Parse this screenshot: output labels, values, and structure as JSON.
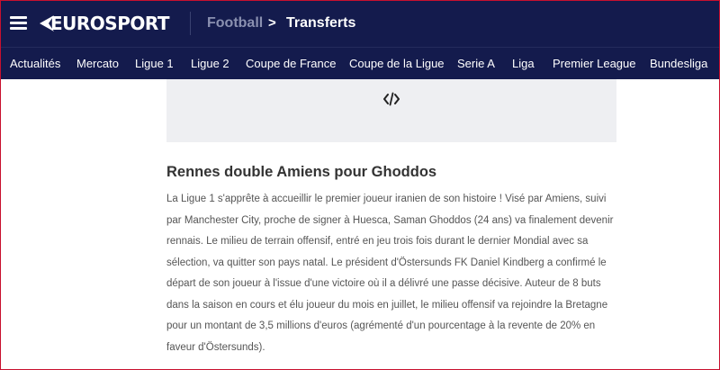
{
  "header": {
    "logo_text": "EUROSPORT",
    "breadcrumb": [
      "Football",
      "Transferts"
    ],
    "breadcrumb_separator": ">"
  },
  "nav": {
    "items": [
      "Actualités",
      "Mercato",
      "Ligue 1",
      "Ligue 2",
      "Coupe de France",
      "Coupe de la Ligue",
      "Serie A",
      "Liga",
      "Premier League",
      "Bundesliga"
    ]
  },
  "embed": {
    "icon": "code-icon"
  },
  "article": {
    "heading": "Rennes double Amiens pour Ghoddos",
    "lines": [
      "La Ligue 1 s'apprête à accueillir le premier joueur iranien de son histoire ! Visé par Amiens, suivi",
      "par Manchester City, proche de signer à Huesca, Saman Ghoddos (24 ans) va finalement devenir",
      "rennais. Le milieu de terrain offensif, entré en jeu trois fois durant le dernier Mondial avec sa",
      "sélection, va quitter son pays natal. Le président d'Östersunds FK Daniel Kindberg a confirmé le",
      "départ de son joueur à l'issue d'une victoire où il a délivré une passe décisive. Auteur de 8 buts",
      "dans la saison en cours et élu joueur du mois en juillet, le milieu offensif va rejoindre la Bretagne",
      "pour un montant de 3,5 millions d'euros (agrémenté d'un pourcentage à la revente de 20% en",
      "faveur d'Östersunds)."
    ]
  },
  "colors": {
    "header_bg": "#141b4d",
    "embed_bg": "#eeeff2",
    "heading_text": "#333333",
    "body_text": "#555555",
    "frame": "#c8102e"
  }
}
